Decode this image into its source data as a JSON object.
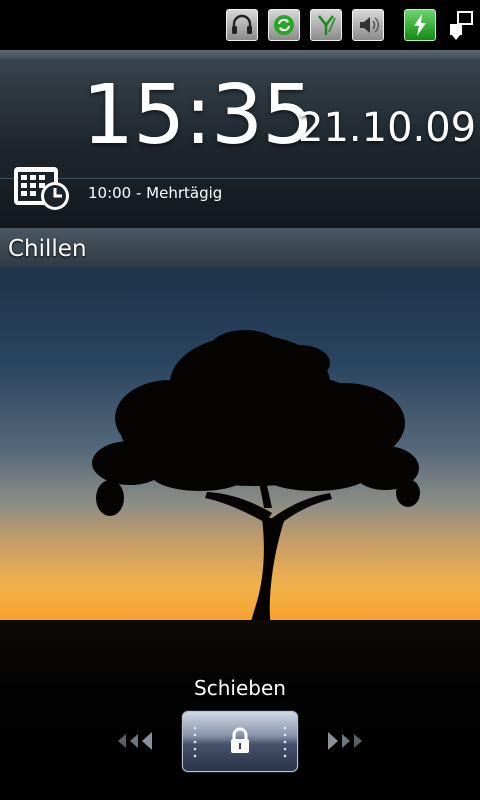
{
  "status_bar": {
    "icons": [
      "headphones-icon",
      "sync-icon",
      "signal-icon",
      "speaker-icon",
      "battery-charging-icon",
      "connection-icon"
    ]
  },
  "clock": {
    "time": "15:35",
    "date": "21.10.09"
  },
  "appointment": {
    "text": "10:00 - Mehrtägig",
    "icon": "calendar-clock-icon"
  },
  "profile": {
    "name": "Chillen"
  },
  "unlock": {
    "label": "Schieben",
    "icon": "lock-icon"
  },
  "colors": {
    "sky_top": "#1e3349",
    "sunset": "#f7a22e",
    "status_green": "#128b12"
  }
}
